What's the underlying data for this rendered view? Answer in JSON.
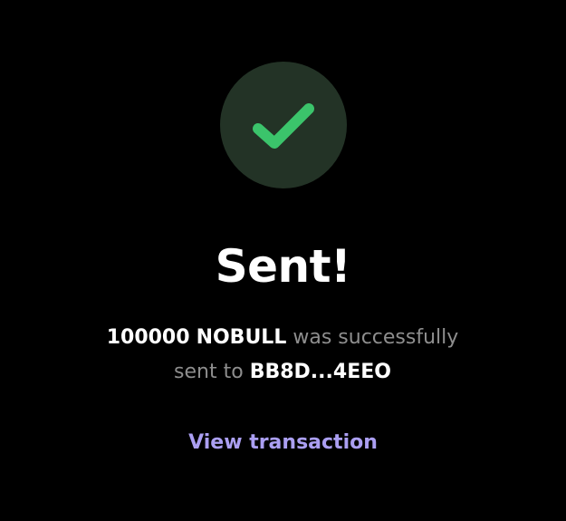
{
  "status": {
    "icon": "checkmark-icon",
    "badge_color": "#233326",
    "check_color": "#3bc46b"
  },
  "title": "Sent!",
  "message": {
    "amount": "100000",
    "token": "NOBULL",
    "middle": "was successfully",
    "prefix_line2": "sent to",
    "recipient": "BB8D...4EEO"
  },
  "actions": {
    "view_transaction": "View transaction",
    "link_color": "#ab9ff2"
  }
}
